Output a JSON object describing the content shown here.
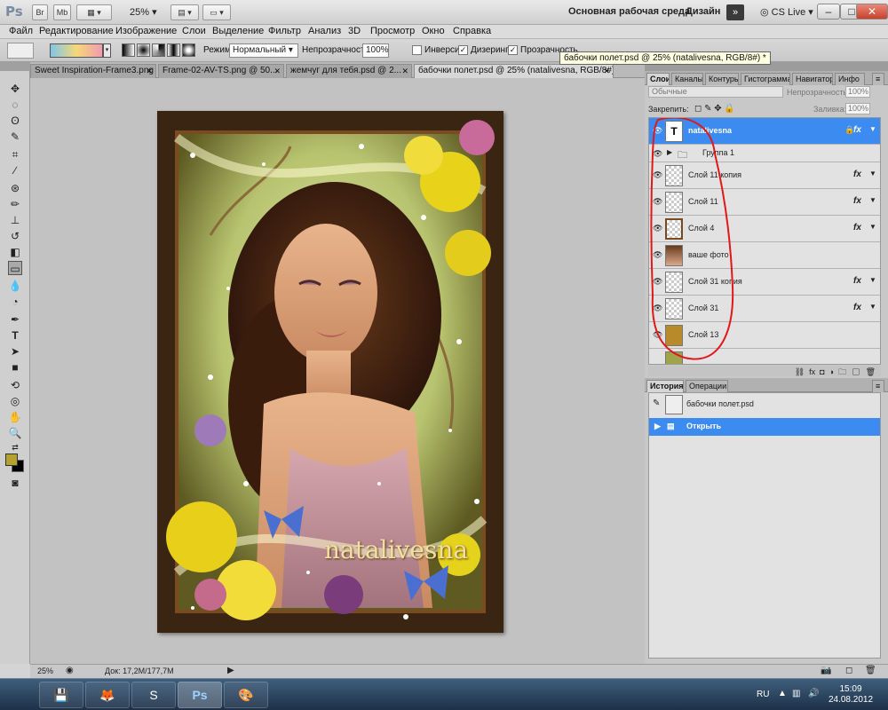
{
  "appbar": {
    "logo": "Ps",
    "br_label": "Br",
    "mb_label": "Mb",
    "zoom": "25%",
    "workspace": "Основная рабочая среда",
    "design": "Дизайн",
    "cslive": "CS Live",
    "min": "–",
    "max": "□",
    "close": "✕"
  },
  "menu": [
    "Файл",
    "Редактирование",
    "Изображение",
    "Слои",
    "Выделение",
    "Фильтр",
    "Анализ",
    "3D",
    "Просмотр",
    "Окно",
    "Справка"
  ],
  "options": {
    "mode_label": "Режим:",
    "mode_value": "Нормальный",
    "opacity_label": "Непрозрачность:",
    "opacity_value": "100%",
    "inverse_label": "Инверсия",
    "dither_label": "Дизеринг",
    "transparency_label": "Прозрачность"
  },
  "tooltip": "бабочки полет.psd @ 25% (natalivesna, RGB/8#) *",
  "tabs": [
    {
      "label": "Sweet Inspiration-Frame3.png",
      "x": "✕"
    },
    {
      "label": "Frame-02-AV-TS.png @ 50...",
      "x": "✕"
    },
    {
      "label": "жемчуг для тебя.psd @ 2...",
      "x": "✕"
    },
    {
      "label": "бабочки полет.psd @ 25% (natalivesna, RGB/8#) *",
      "x": "✕"
    }
  ],
  "canvas": {
    "watermark": "natalivesna"
  },
  "layers_panel": {
    "tabs": [
      "Слои",
      "Каналы",
      "Контуры",
      "Гистограмма",
      "Навигатор",
      "Инфо"
    ],
    "blend_mode": "Обычные",
    "opacity_label": "Непрозрачность:",
    "opacity_value": "100%",
    "lock_label": "Закрепить:",
    "fill_label": "Заливка:",
    "fill_value": "100%",
    "layers": [
      {
        "name": "natalivesna",
        "fx": "fx"
      },
      {
        "name": "Группа 1",
        "fx": ""
      },
      {
        "name": "Слой 11 копия",
        "fx": "fx"
      },
      {
        "name": "Слой 11",
        "fx": "fx"
      },
      {
        "name": "Слой 4",
        "fx": "fx"
      },
      {
        "name": "ваше фото",
        "fx": ""
      },
      {
        "name": "Слой 31 копия",
        "fx": "fx"
      },
      {
        "name": "Слой 31",
        "fx": "fx"
      },
      {
        "name": "Слой 13",
        "fx": ""
      }
    ]
  },
  "history_panel": {
    "tabs": [
      "История",
      "Операции"
    ],
    "snapshot": "бабочки полет.psd",
    "step": "Открыть"
  },
  "status": {
    "zoom": "25%",
    "doc": "Док: 17,2М/177,7М"
  },
  "taskbar": {
    "lang": "RU",
    "time": "15:09",
    "date": "24.08.2012"
  },
  "colors": {
    "foreground": "#b5a22e",
    "background": "#000000",
    "selection": "#3c8bf0"
  }
}
